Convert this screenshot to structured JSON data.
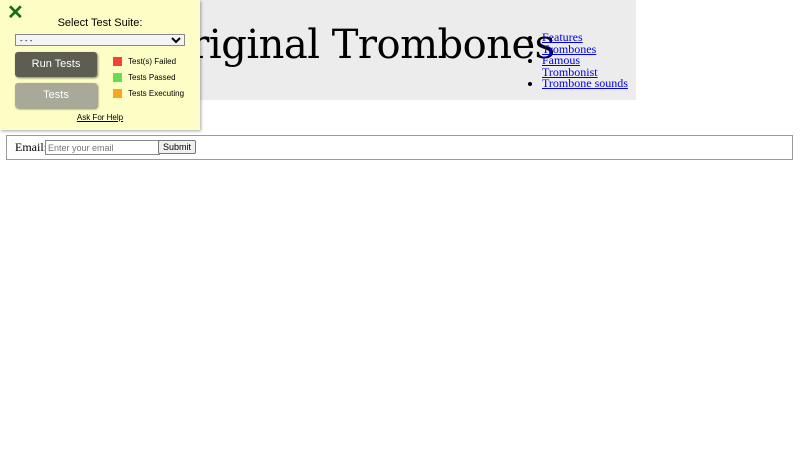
{
  "header": {
    "title": "Original Trombones",
    "nav": [
      {
        "label": "Features Trombones"
      },
      {
        "label": "Famous Trombonist"
      },
      {
        "label": "Trombone sounds"
      }
    ]
  },
  "form": {
    "email_label": "Email:",
    "email_placeholder": "Enter your email",
    "email_value": "",
    "submit_label": "Submit"
  },
  "runner": {
    "close_icon": "close-x-icon",
    "title": "Select Test Suite:",
    "select_value": "- - -",
    "run_label": "Run Tests",
    "tests_label": "Tests",
    "legend": [
      {
        "label": "Test(s) Failed",
        "color": "#f44336"
      },
      {
        "label": "Tests Passed",
        "color": "#66dd55"
      },
      {
        "label": "Tests Executing",
        "color": "#f5a623"
      }
    ],
    "help_label": "Ask For Help"
  }
}
